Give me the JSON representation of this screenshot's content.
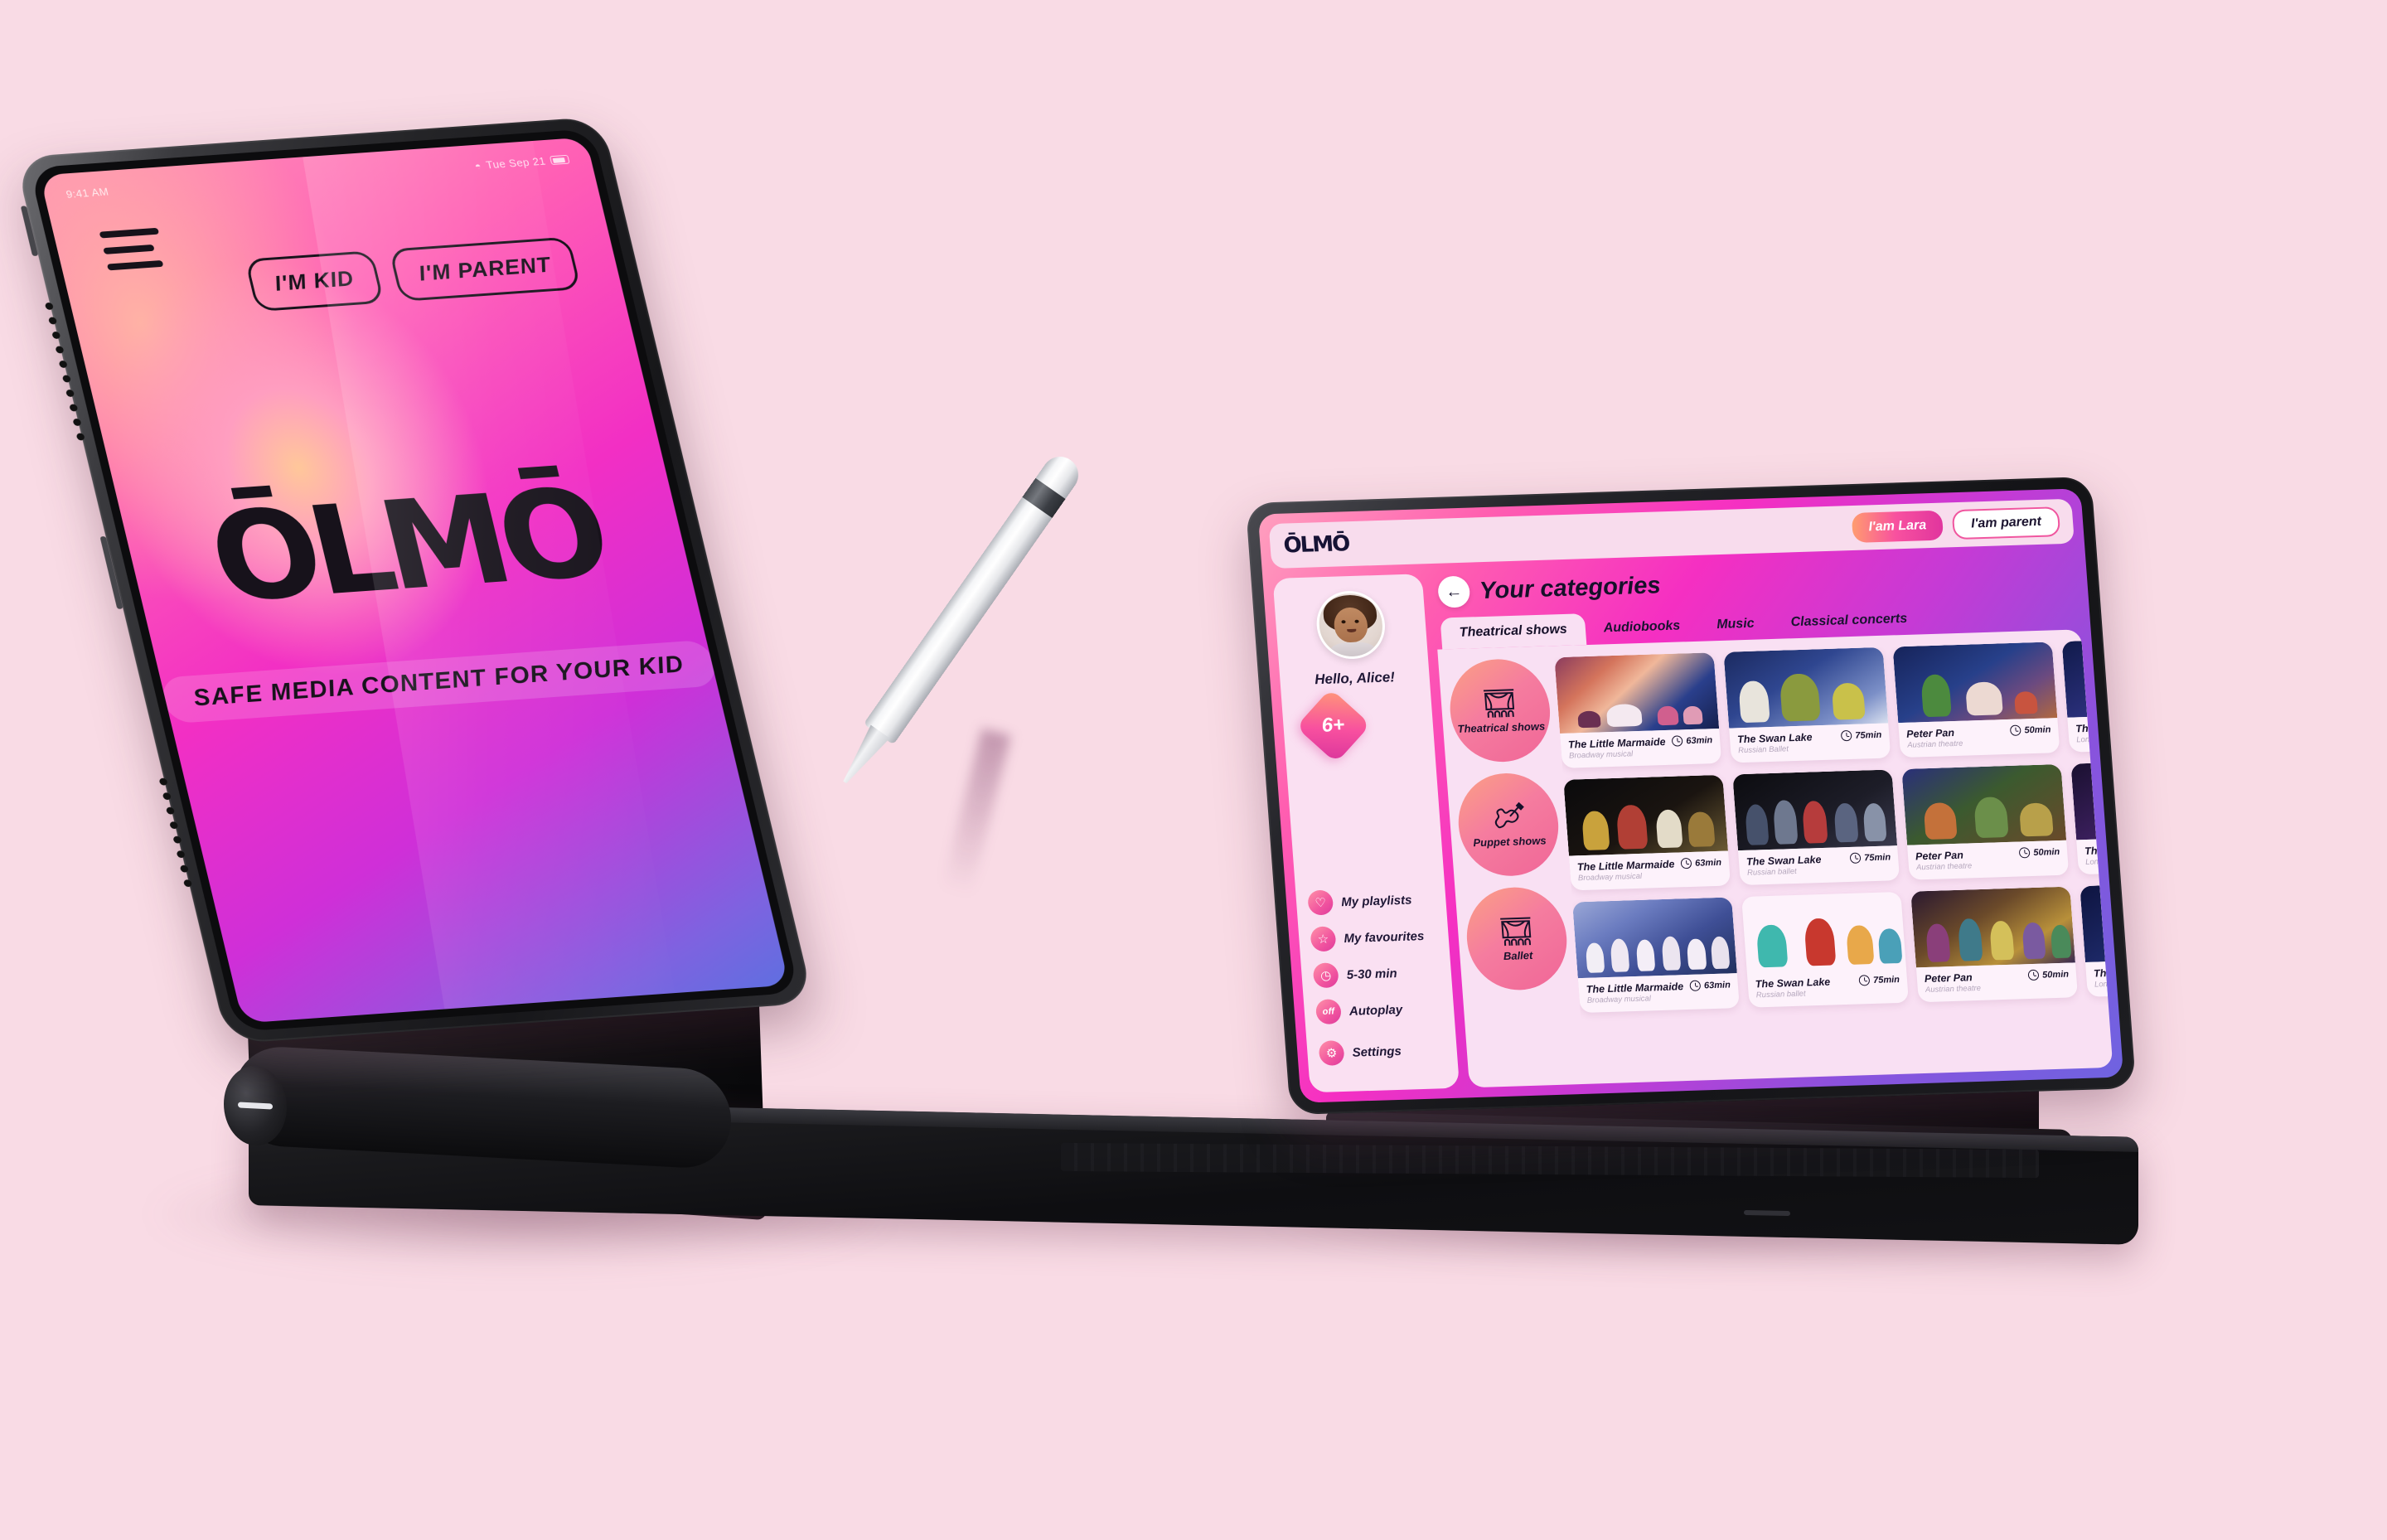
{
  "background_color": "#f9dbe5",
  "brand": {
    "name": "ŌLMŌ",
    "accent": "#f0569f",
    "dark": "#171335"
  },
  "left_tablet": {
    "status_bar": {
      "time": "9:41 AM",
      "date": "Tue Sep 21",
      "wifi_icon": "wifi-icon",
      "battery_icon": "battery-icon"
    },
    "menu_icon": "hamburger-menu-icon",
    "buttons": [
      {
        "label": "I'M KID",
        "style": "outline"
      },
      {
        "label": "I'M PARENT",
        "style": "outline"
      }
    ],
    "logo": "ŌLMŌ",
    "tagline": "SAFE MEDIA CONTENT FOR YOUR KID"
  },
  "right_tablet": {
    "topbar": {
      "logo": "ŌLMŌ",
      "buttons": [
        {
          "label": "I'am Lara",
          "style": "filled"
        },
        {
          "label": "I'am parent",
          "style": "outline"
        }
      ]
    },
    "sidebar": {
      "avatar": "user-avatar",
      "greeting": "Hello, Alice!",
      "age_badge": "6+",
      "items": [
        {
          "label": "My playlists",
          "icon": "heart-icon"
        },
        {
          "label": "My favourites",
          "icon": "star-icon"
        },
        {
          "label": "5-30 min",
          "icon": "clock-icon"
        },
        {
          "label": "Autoplay",
          "icon": "off-toggle-icon",
          "state": "off"
        }
      ],
      "settings": {
        "label": "Settings",
        "icon": "gear-icon"
      }
    },
    "main": {
      "back_icon": "back-arrow-icon",
      "title": "Your categories",
      "tabs": [
        {
          "label": "Theatrical shows",
          "active": true
        },
        {
          "label": "Audiobooks",
          "active": false
        },
        {
          "label": "Music",
          "active": false
        },
        {
          "label": "Classical concerts",
          "active": false
        }
      ],
      "categories": [
        {
          "name": "Theatrical shows",
          "icon": "theater-curtain-icon"
        },
        {
          "name": "Puppet shows",
          "icon": "violin-icon"
        },
        {
          "name": "Ballet",
          "icon": "theater-curtain-icon"
        }
      ],
      "rows": [
        {
          "cards": [
            {
              "title": "The Little Marmaide",
              "subtitle": "Broadway musical",
              "duration": "63min",
              "thumb": "mermaid-boat-stage"
            },
            {
              "title": "The Swan Lake",
              "subtitle": "Russian Ballet",
              "duration": "75min",
              "thumb": "peter-pan-window-stage"
            },
            {
              "title": "Peter Pan",
              "subtitle": "Austrian theatre",
              "duration": "50min",
              "thumb": "peter-pan-tree-stage"
            },
            {
              "title": "The cu",
              "subtitle": "London T",
              "duration": "",
              "thumb": "concert-stage"
            }
          ]
        },
        {
          "cards": [
            {
              "title": "The Little Marmaide",
              "subtitle": "Broadway musical",
              "duration": "63min",
              "thumb": "puppet-folk-stage"
            },
            {
              "title": "The Swan Lake",
              "subtitle": "Russian ballet",
              "duration": "75min",
              "thumb": "ensemble-dark-stage"
            },
            {
              "title": "Peter Pan",
              "subtitle": "Austrian theatre",
              "duration": "50min",
              "thumb": "living-room-stage"
            },
            {
              "title": "The cu",
              "subtitle": "London T",
              "duration": "",
              "thumb": "circus-stage"
            }
          ]
        },
        {
          "cards": [
            {
              "title": "The Little Marmaide",
              "subtitle": "Broadway musical",
              "duration": "63min",
              "thumb": "swan-lake-mountains"
            },
            {
              "title": "The Swan Lake",
              "subtitle": "Russian ballet",
              "duration": "75min",
              "thumb": "teal-fantasy-stage"
            },
            {
              "title": "Peter Pan",
              "subtitle": "Austrian theatre",
              "duration": "50min",
              "thumb": "gold-palace-ballet"
            },
            {
              "title": "The cu",
              "subtitle": "London T",
              "duration": "",
              "thumb": "blue-night-stage"
            }
          ]
        }
      ]
    }
  },
  "stylus": {
    "name": "apple-pencil"
  }
}
